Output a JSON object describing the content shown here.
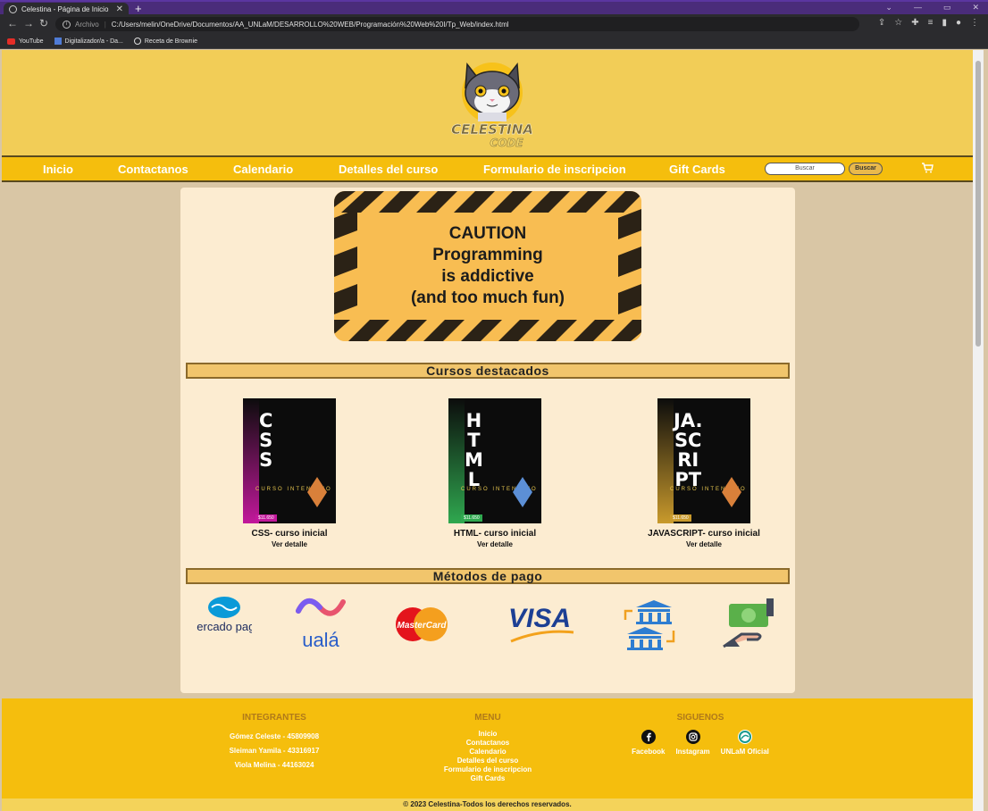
{
  "browser": {
    "tab_title": "Celestina - Página de Inicio",
    "new_tab": "+",
    "close_tab": "✕",
    "url_scheme_label": "Archivo",
    "url": "C:/Users/melin/OneDrive/Documentos/AA_UNLaM/DESARROLLO%20WEB/Programación%20Web%20I/Tp_Web/index.html",
    "bookmarks": [
      "YouTube",
      "Digitalizador/a - Da...",
      "Receta de Brownie"
    ]
  },
  "header": {
    "logo_text_1": "CELESTINA",
    "logo_text_2": "CODE"
  },
  "nav": {
    "items": [
      "Inicio",
      "Contactanos",
      "Calendario",
      "Detalles del curso",
      "Formulario de inscripcion",
      "Gift Cards"
    ],
    "search_placeholder": "Buscar",
    "search_button": "Buscar"
  },
  "banner": {
    "line1": "CAUTION",
    "line2": "Programming",
    "line3": "is addictive",
    "line4": "(and too much fun)"
  },
  "featured": {
    "title": "Cursos destacados",
    "courses": [
      {
        "poster": "CSS",
        "title": "CSS- curso inicial",
        "link": "Ver detalle",
        "accent": "#c2189b"
      },
      {
        "poster": "HTML",
        "title": "HTML- curso inicial",
        "link": "Ver detalle",
        "accent": "#2fa84f"
      },
      {
        "poster": "JA. SC RI PT",
        "title": "JAVASCRIPT- curso inicial",
        "link": "Ver detalle",
        "accent": "#c99a2c"
      }
    ],
    "poster_sub": "CURSO INTENSIVO",
    "poster_price": "$11.650"
  },
  "payments": {
    "title": "Métodos de pago",
    "methods": [
      "mercado pago",
      "ualá",
      "MasterCard",
      "VISA",
      "transferencia-bancaria",
      "efectivo"
    ]
  },
  "footer": {
    "integrantes_title": "INTEGRANTES",
    "integrantes": [
      "Gómez Celeste - 45809908",
      "Sleiman Yamila - 43316917",
      "Viola Melina - 44163024"
    ],
    "menu_title": "MENU",
    "menu": [
      "Inicio",
      "Contactanos",
      "Calendario",
      "Detalles del curso",
      "Formulario de inscripcion",
      "Gift Cards"
    ],
    "social_title": "SIGUENOS",
    "social": [
      "Facebook",
      "Instagram",
      "UNLaM Oficial"
    ],
    "copyright": "© 2023 Celestina-Todos los derechos reservados."
  },
  "colors": {
    "header_bg": "#f2cd57",
    "nav_bg": "#f5be0d",
    "page_bg": "#d9c6a5",
    "content_bg": "#fcecd1",
    "section_title_bg": "#f1c56c"
  }
}
